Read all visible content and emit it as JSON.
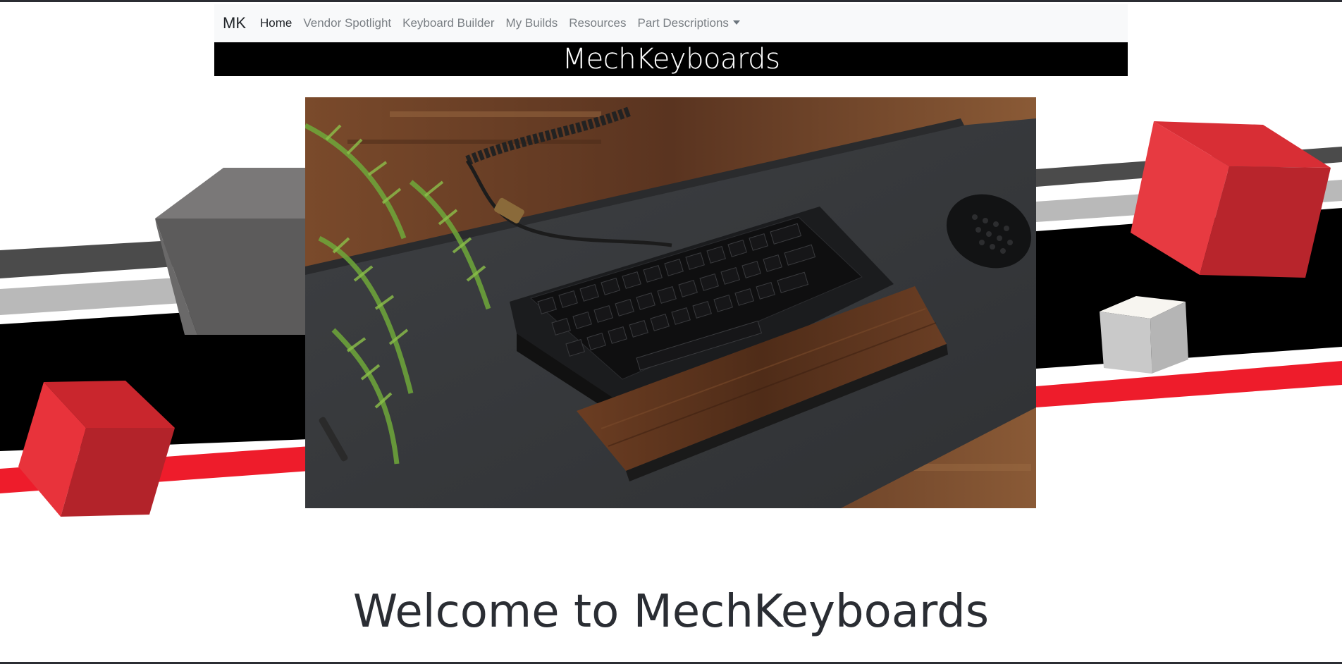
{
  "nav": {
    "brand": "MK",
    "items": [
      {
        "label": "Home"
      },
      {
        "label": "Vendor Spotlight"
      },
      {
        "label": "Keyboard Builder"
      },
      {
        "label": "My Builds"
      },
      {
        "label": "Resources"
      },
      {
        "label": "Part Descriptions"
      }
    ]
  },
  "banner": {
    "title": "MechKeyboards"
  },
  "hero": {
    "alt_icon": "keyboard-photo"
  },
  "main": {
    "heading": "Welcome to MechKeyboards"
  },
  "colors": {
    "accent_red": "#ee1c2b",
    "navbar_bg": "#f8f9fa",
    "banner_bg": "#000000"
  }
}
